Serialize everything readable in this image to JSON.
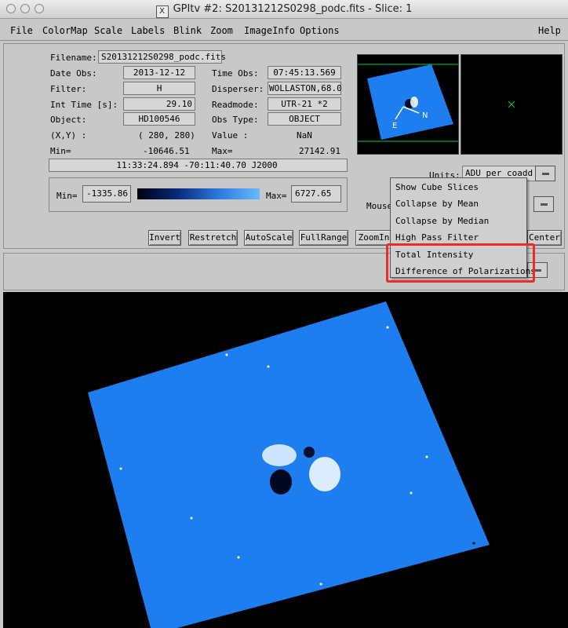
{
  "window": {
    "title": "GPItv #2:  S20131212S0298_podc.fits  -  Slice: 1"
  },
  "menubar": {
    "items": [
      "File",
      "ColorMap",
      "Scale",
      "Labels",
      "Blink",
      "Zoom",
      "ImageInfo",
      "Options"
    ],
    "help": "Help"
  },
  "info": {
    "filename_label": "Filename:",
    "filename": "S20131212S0298_podc.fits",
    "date_label": "Date Obs:",
    "date": "2013-12-12",
    "filter_label": "Filter:",
    "filter": "H",
    "inttime_label": "Int Time [s]:",
    "inttime": "29.10",
    "object_label": "Object:",
    "object": "HD100546",
    "xy_label": "(X,Y) :",
    "xy": "( 280, 280)",
    "min_label": "Min=",
    "min": "-10646.51",
    "timeobs_label": "Time Obs:",
    "timeobs": "07:45:13.569",
    "disperser_label": "Disperser:",
    "disperser": "WOLLASTON,68.0",
    "readmode_label": "Readmode:",
    "readmode": "UTR-21 *2",
    "obstype_label": "Obs Type:",
    "obstype": "OBJECT",
    "value_label": "Value :",
    "value": "NaN",
    "max_label": "Max=",
    "max": "27142.91",
    "coords": "11:33:24.894  -70:11:40.70  J2000"
  },
  "scale": {
    "min_label": "Min=",
    "min": "-1335.86",
    "max_label": "Max=",
    "max": "6727.65"
  },
  "units": {
    "label": "Units:",
    "value": "ADU per coadd"
  },
  "mouse_label": "Mouse",
  "buttons": {
    "invert": "Invert",
    "restretch": "Restretch",
    "autoscale": "AutoScale",
    "fullrange": "FullRange",
    "zoomin": "ZoomIn",
    "center": "Center"
  },
  "compass": {
    "e": "E",
    "n": "N"
  },
  "dropdown": {
    "items": [
      "Show Cube Slices",
      "Collapse by Mean",
      "Collapse by Median",
      "High Pass Filter",
      "Total Intensity",
      "Difference of Polarizations"
    ]
  },
  "colors": {
    "image_blue": "#1e7ef0",
    "highlight": "#ee2a2a",
    "panner_line": "#00cc44"
  }
}
